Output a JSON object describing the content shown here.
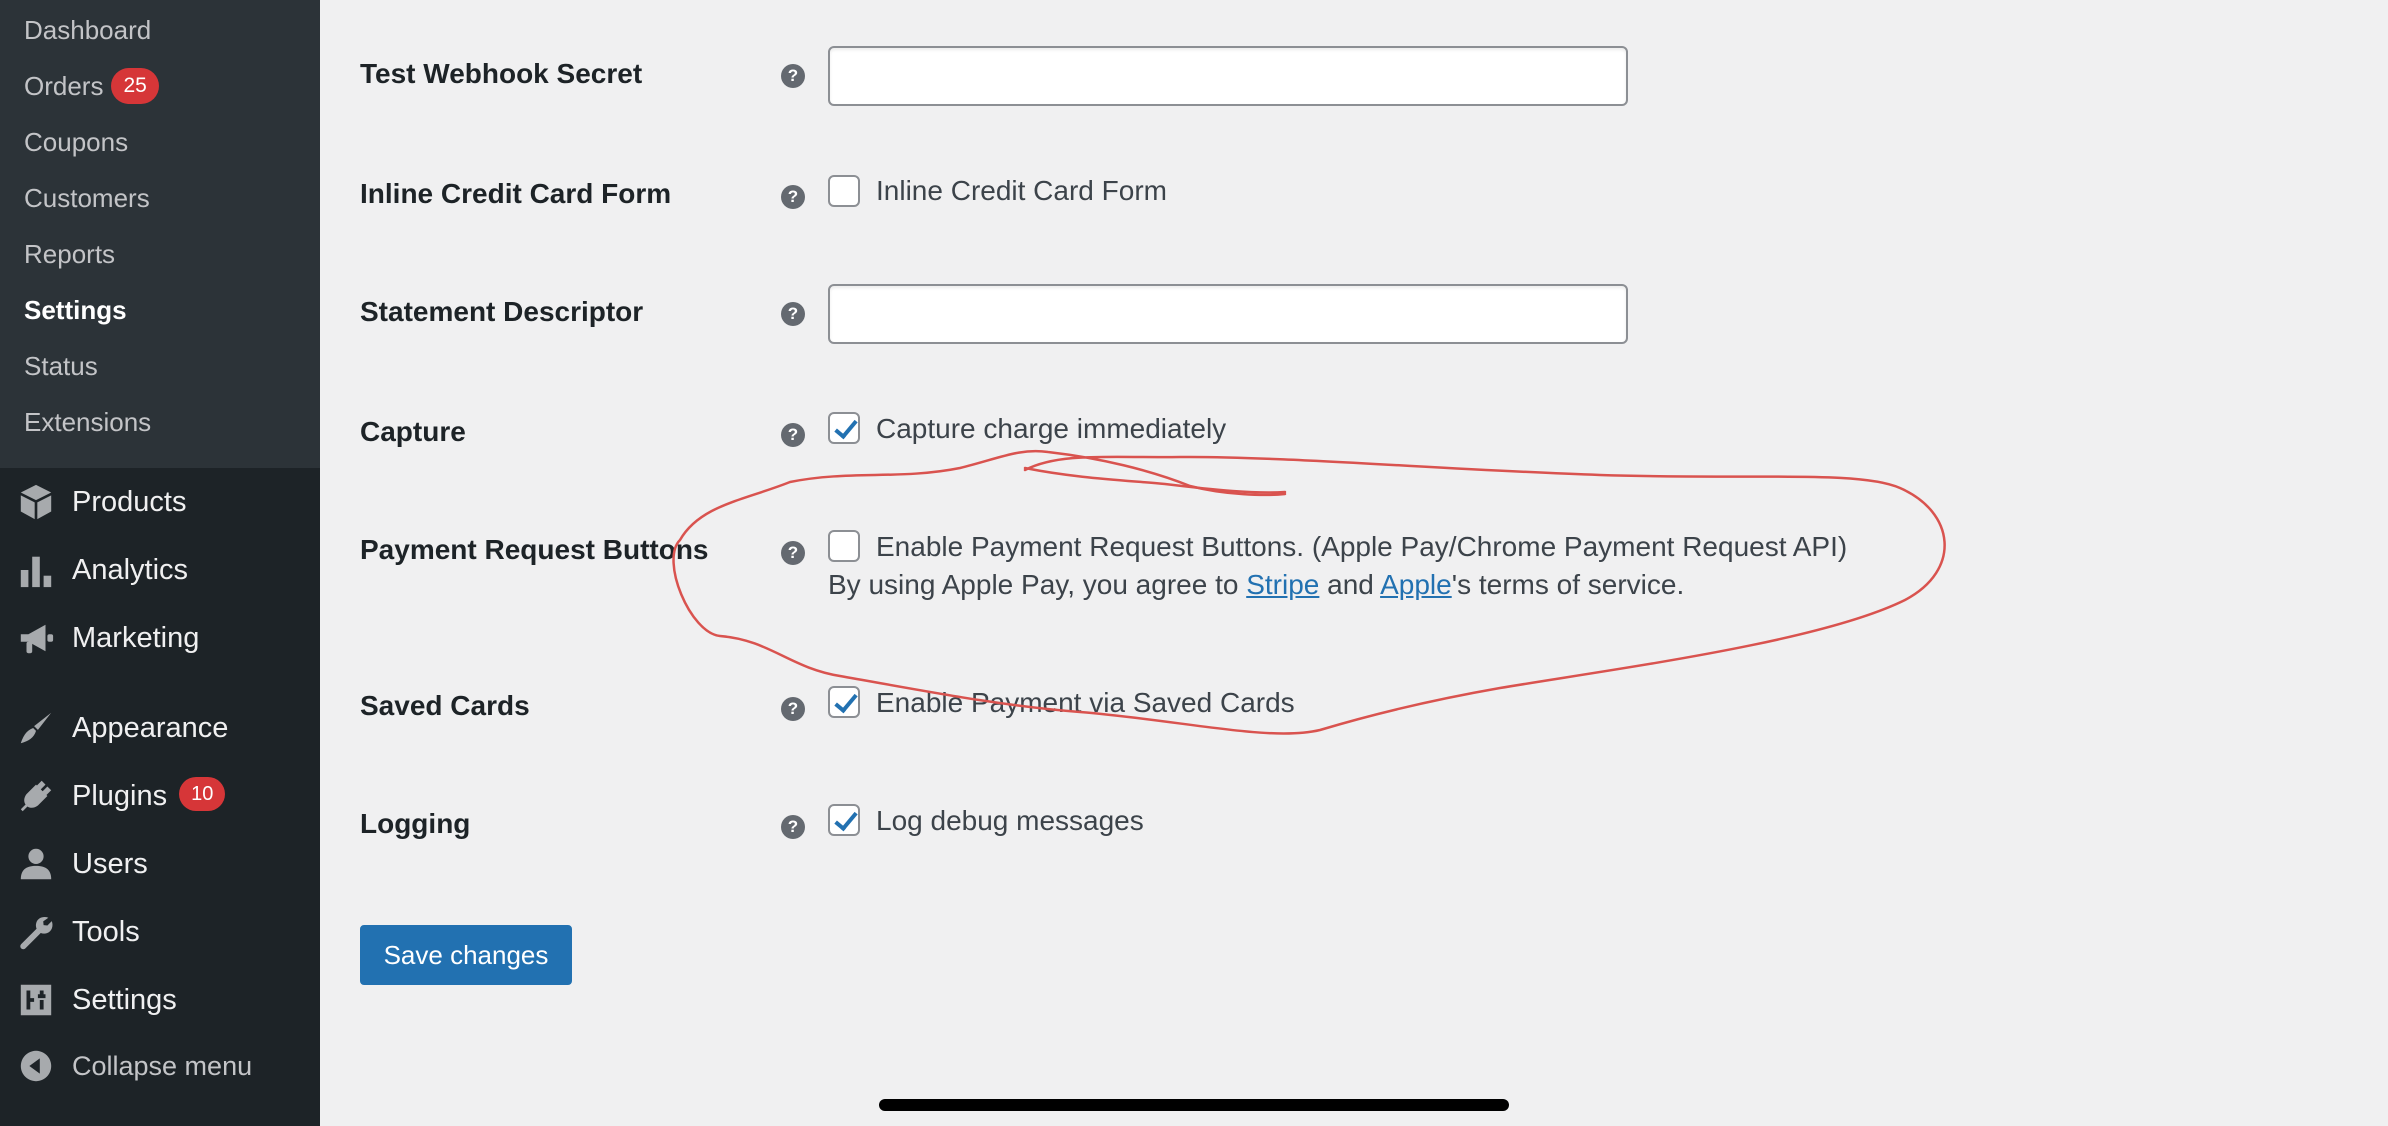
{
  "sidebar": {
    "submenu": [
      {
        "label": "Dashboard"
      },
      {
        "label": "Orders",
        "badge": "25"
      },
      {
        "label": "Coupons"
      },
      {
        "label": "Customers"
      },
      {
        "label": "Reports"
      },
      {
        "label": "Settings",
        "current": true
      },
      {
        "label": "Status"
      },
      {
        "label": "Extensions"
      }
    ],
    "menu": [
      {
        "label": "Products",
        "icon": "cube-icon"
      },
      {
        "label": "Analytics",
        "icon": "bar-chart-icon"
      },
      {
        "label": "Marketing",
        "icon": "megaphone-icon"
      },
      {
        "label": "Appearance",
        "icon": "paintbrush-icon"
      },
      {
        "label": "Plugins",
        "icon": "plug-icon",
        "badge": "10"
      },
      {
        "label": "Users",
        "icon": "user-icon"
      },
      {
        "label": "Tools",
        "icon": "wrench-icon"
      },
      {
        "label": "Settings",
        "icon": "sliders-icon"
      }
    ],
    "collapse_label": "Collapse menu",
    "badge_color": "#d63638"
  },
  "form": {
    "rows": [
      {
        "label": "Test Webhook Secret",
        "type": "text",
        "value": ""
      },
      {
        "label": "Inline Credit Card Form",
        "type": "checkbox",
        "checked": false,
        "checkbox_label": "Inline Credit Card Form"
      },
      {
        "label": "Statement Descriptor",
        "type": "text",
        "value": ""
      },
      {
        "label": "Capture",
        "type": "checkbox",
        "checked": true,
        "checkbox_label": "Capture charge immediately"
      },
      {
        "label": "Payment Request Buttons",
        "type": "checkbox",
        "checked": false,
        "checkbox_label": "Enable Payment Request Buttons. (Apple Pay/Chrome Payment Request API)"
      },
      {
        "label": "Saved Cards",
        "type": "checkbox",
        "checked": true,
        "checkbox_label": "Enable Payment via Saved Cards"
      },
      {
        "label": "Logging",
        "type": "checkbox",
        "checked": true,
        "checkbox_label": "Log debug messages"
      }
    ],
    "help_glyph": "?",
    "payment_desc": {
      "prefix": "By using Apple Pay, you agree to ",
      "link1": "Stripe",
      "middle": " and ",
      "link2": "Apple",
      "suffix": "'s terms of service."
    },
    "save_label": "Save changes"
  },
  "colors": {
    "accent": "#2271b1",
    "annotation": "#d9534f"
  }
}
